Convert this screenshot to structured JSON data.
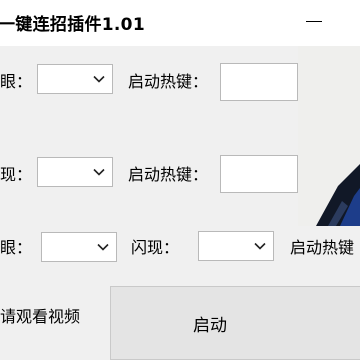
{
  "window": {
    "title": "一键连招插件1.01"
  },
  "rows": [
    {
      "label": "眼：",
      "select_value": "",
      "hotkey_label": "启动热键：",
      "hotkey_value": ""
    },
    {
      "label": "现：",
      "select_value": "",
      "hotkey_label": "启动热键：",
      "hotkey_value": ""
    },
    {
      "label": "眼：",
      "select_value": "",
      "flash_label": "闪现：",
      "flash_value": "",
      "hotkey_label": "启动热键",
      "hotkey_value": ""
    }
  ],
  "footer": {
    "watch_video": "请观看视频",
    "start_button": "启动"
  },
  "colors": {
    "window_bg": "#f0f0f0",
    "titlebar_bg": "#ffffff",
    "field_border": "#b9b9b9",
    "button_bg": "#e4e4e4"
  },
  "icons": {
    "dropdown": "chevron-down-icon",
    "minimize": "minimize-icon"
  }
}
